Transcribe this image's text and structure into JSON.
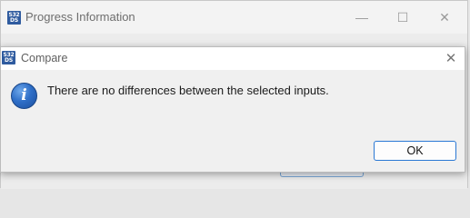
{
  "background_window": {
    "title": "Progress Information",
    "icon_text_top": "S32",
    "icon_text_bottom": "DS",
    "minimize_glyph": "—",
    "maximize_glyph": "☐",
    "close_glyph": "✕"
  },
  "dialog": {
    "title": "Compare",
    "icon_text_top": "S32",
    "icon_text_bottom": "DS",
    "close_glyph": "✕",
    "info_glyph": "i",
    "message": "There are no differences between the selected inputs.",
    "ok_label": "OK"
  },
  "colors": {
    "accent_border": "#2a78d4",
    "info_blue": "#2f6fc8",
    "app_icon": "#2f5b9f"
  }
}
